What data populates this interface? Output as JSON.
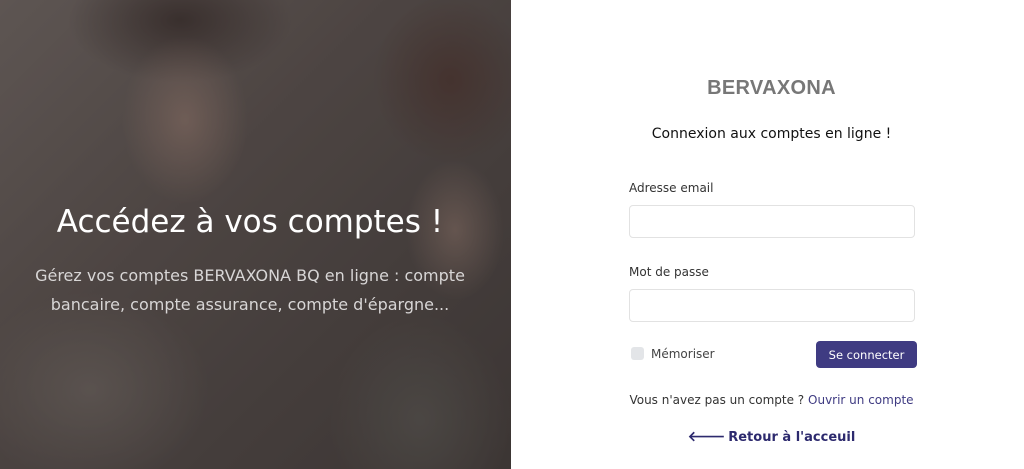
{
  "hero": {
    "title": "Accédez à vos comptes !",
    "subtitle": "Gérez vos comptes BERVAXONA BQ en ligne : compte bancaire, compte assurance, compte d'épargne..."
  },
  "login": {
    "brand": "BERVAXONA",
    "subtitle": "Connexion aux comptes en ligne !",
    "email_label": "Adresse email",
    "email_value": "",
    "password_label": "Mot de passe",
    "password_value": "",
    "remember_label": "Mémoriser",
    "remember_checked": false,
    "submit_label": "Se connecter",
    "no_account_text": "Vous n'avez pas un compte ?",
    "open_account_link": "Ouvrir un compte",
    "back_icon": "arrow-left-icon",
    "back_label": "Retour à l'acceuil"
  },
  "colors": {
    "accent": "#3f3b82",
    "brand": "#777777"
  }
}
